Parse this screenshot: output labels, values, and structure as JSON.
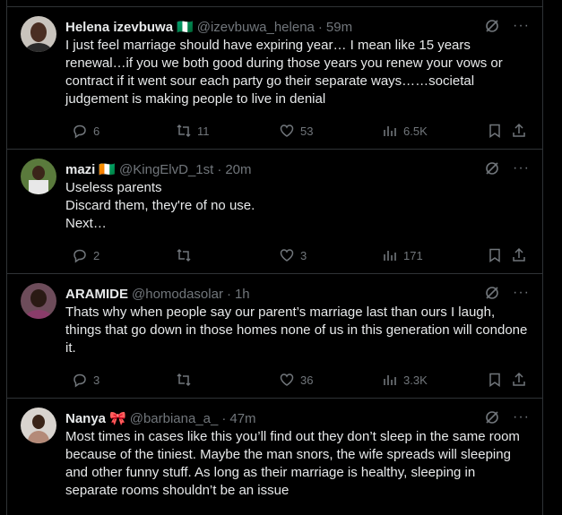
{
  "tweets": [
    {
      "name": "Helena izevbuwa",
      "flag": "🇳🇬",
      "handle": "@izevbuwa_helena",
      "time": "59m",
      "text": "I just feel marriage should have expiring year… I mean like 15 years renewal…if you we both good during those years you renew your vows or contract if it went sour each party go their separate ways……societal judgement is making people to live in denial",
      "replies": "6",
      "retweets": "11",
      "likes": "53",
      "views": "6.5K"
    },
    {
      "name": "mazi",
      "flag": "🇨🇮",
      "handle": "@KingElvD_1st",
      "time": "20m",
      "text": "Useless parents\nDiscard them, they're of no use.\nNext…",
      "replies": "2",
      "retweets": "",
      "likes": "3",
      "views": "171"
    },
    {
      "name": "ARAMIDE",
      "flag": "",
      "handle": "@homodasolar",
      "time": "1h",
      "text": "Thats why when people say our parent’s marriage last than ours I laugh, things that go down in those homes none of us in this generation will condone it.",
      "replies": "3",
      "retweets": "",
      "likes": "36",
      "views": "3.3K"
    },
    {
      "name": "Nanya",
      "flag": "🎀",
      "handle": "@barbiana_a_",
      "time": "47m",
      "text": "Most times in cases like this you’ll find out they don’t sleep in the same room because of the tiniest. Maybe the man snors, the wife spreads will sleeping and other funny stuff. As long as their marriage is healthy, sleeping in separate rooms shouldn’t be an issue",
      "replies": "",
      "retweets": "",
      "likes": "",
      "views": ""
    }
  ],
  "dot": "·",
  "more": "···"
}
